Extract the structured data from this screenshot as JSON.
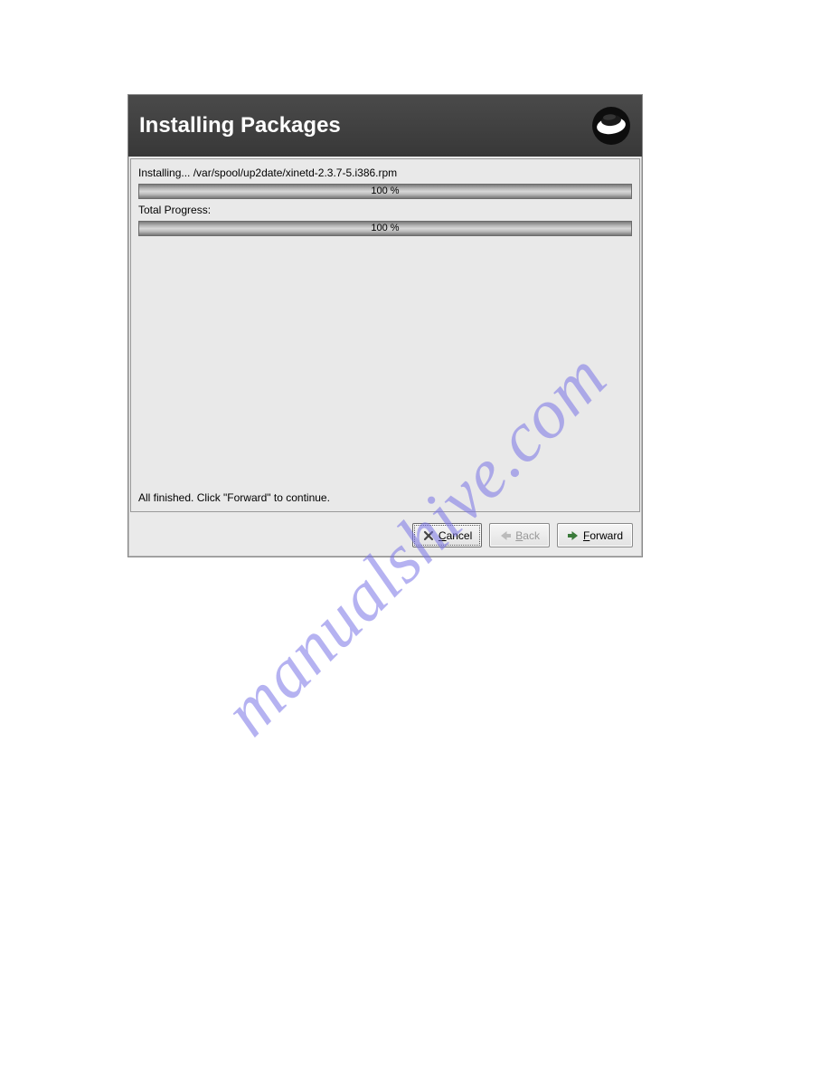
{
  "dialog": {
    "title": "Installing Packages",
    "installing_text": "Installing... /var/spool/up2date/xinetd-2.3.7-5.i386.rpm",
    "progress1_label": "100 %",
    "total_label": "Total Progress:",
    "progress2_label": "100 %",
    "finished_text": "All finished.  Click \"Forward\" to continue."
  },
  "buttons": {
    "cancel_prefix": "C",
    "cancel_rest": "ancel",
    "back_prefix": "B",
    "back_rest": "ack",
    "forward_prefix": "F",
    "forward_rest": "orward"
  },
  "watermark": "manualshive.com"
}
